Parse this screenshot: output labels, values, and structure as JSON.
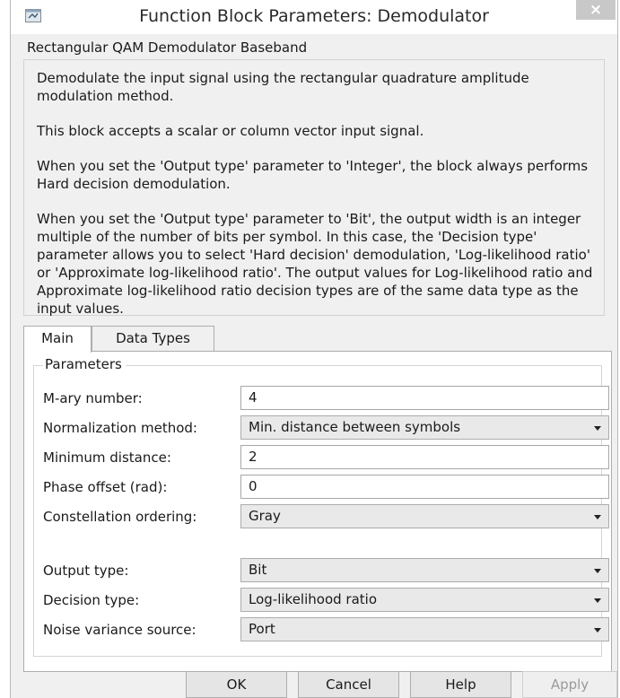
{
  "window": {
    "title": "Function Block Parameters: Demodulator",
    "close_label": "×"
  },
  "block_name": "Rectangular QAM Demodulator Baseband",
  "description": [
    "Demodulate the input signal using the rectangular quadrature amplitude modulation method.",
    "This block accepts a scalar or column vector input signal.",
    "When you set the 'Output type' parameter to 'Integer', the block always performs Hard decision demodulation.",
    "When you set the 'Output type' parameter to 'Bit', the output width is an integer multiple of the number of bits per symbol. In this case, the 'Decision type' parameter allows you to select 'Hard decision' demodulation, 'Log-likelihood ratio' or 'Approximate log-likelihood ratio'. The output values for Log-likelihood ratio and Approximate log-likelihood ratio decision types are of the same data type as the input values."
  ],
  "tabs": [
    {
      "label": "Main",
      "active": true
    },
    {
      "label": "Data Types",
      "active": false
    }
  ],
  "parameters": {
    "group_label": "Parameters",
    "m_ary": {
      "label": "M-ary number:",
      "value": "4"
    },
    "normalization": {
      "label": "Normalization method:",
      "value": "Min. distance between symbols"
    },
    "min_distance": {
      "label": "Minimum distance:",
      "value": "2"
    },
    "phase_offset": {
      "label": "Phase offset (rad):",
      "value": "0"
    },
    "constellation": {
      "label": "Constellation ordering:",
      "value": "Gray"
    },
    "output_type": {
      "label": "Output type:",
      "value": "Bit"
    },
    "decision_type": {
      "label": "Decision type:",
      "value": "Log-likelihood ratio"
    },
    "noise_source": {
      "label": "Noise variance source:",
      "value": "Port"
    }
  },
  "buttons": {
    "ok": "OK",
    "cancel": "Cancel",
    "help": "Help",
    "apply": "Apply"
  }
}
